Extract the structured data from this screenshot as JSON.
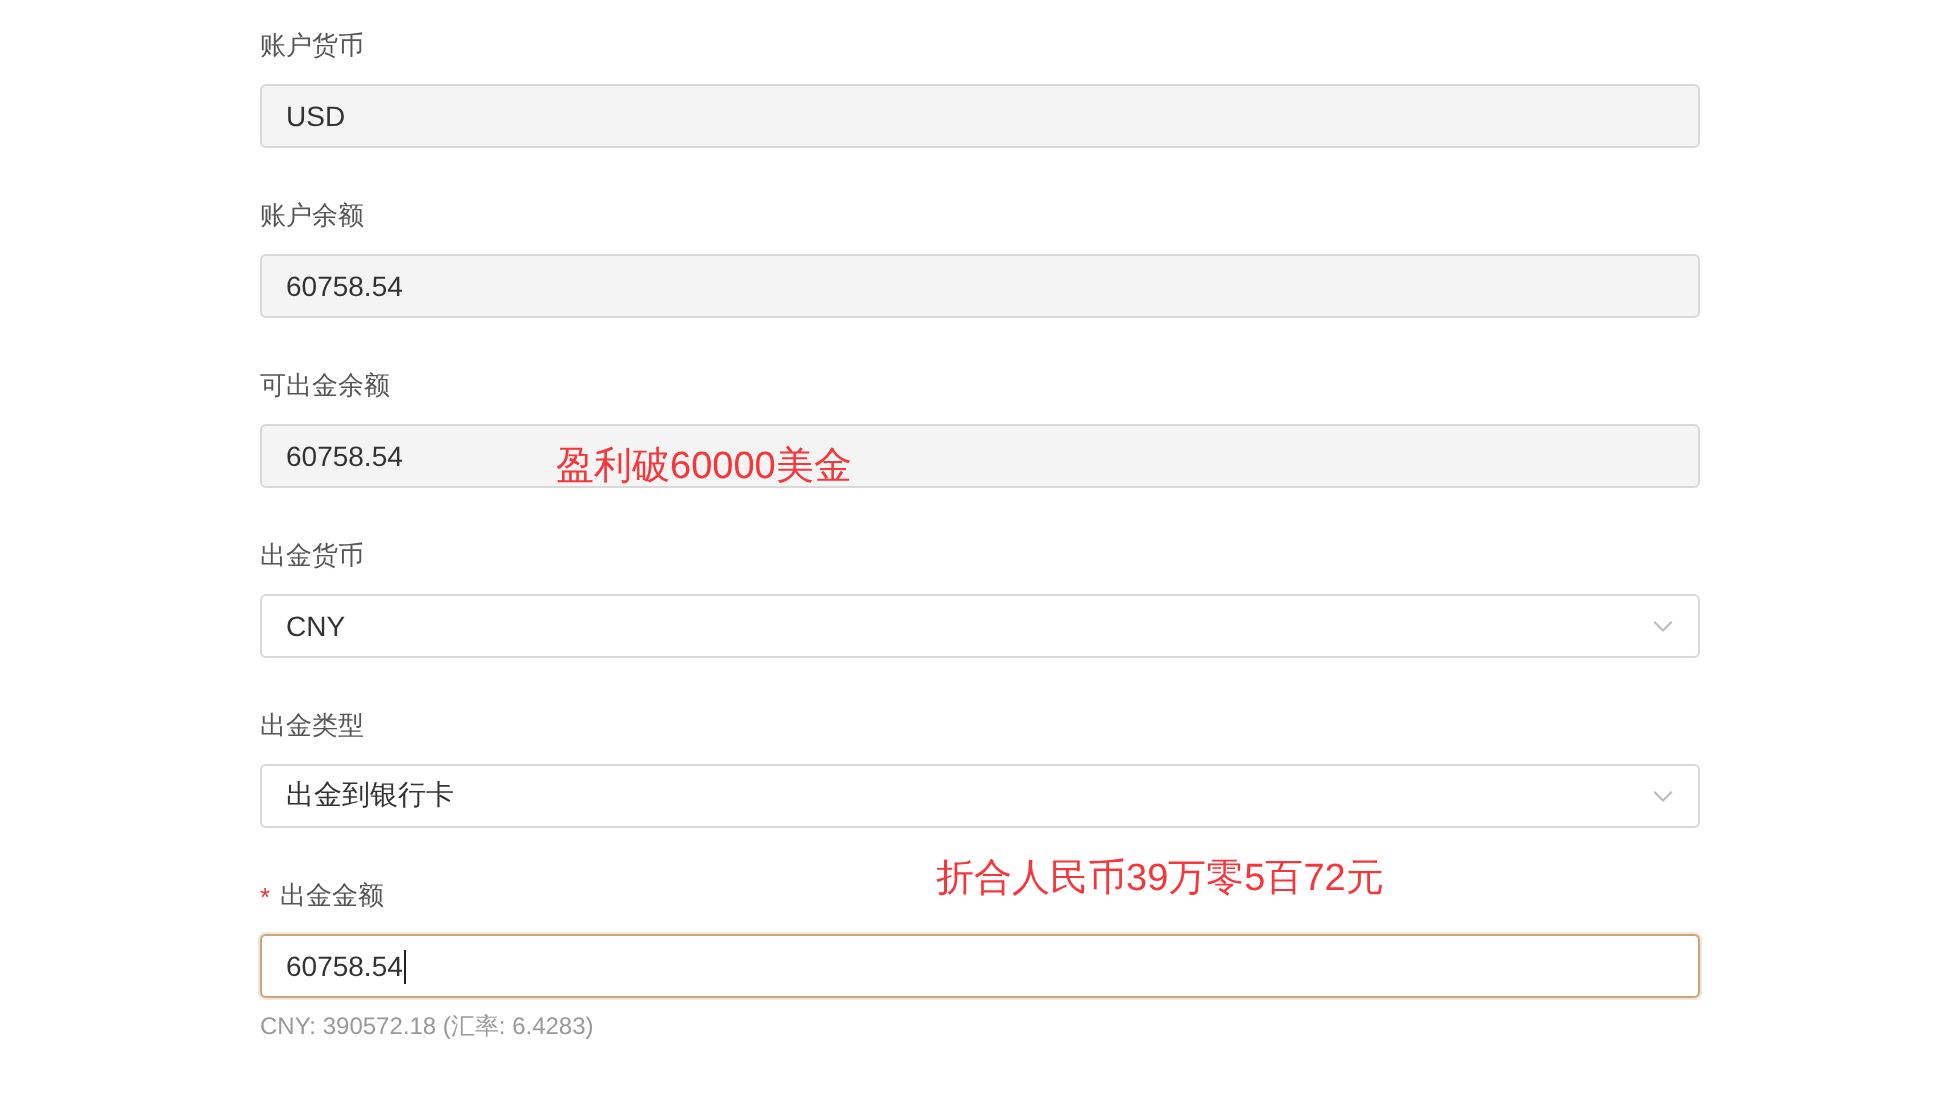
{
  "fields": [
    {
      "label": "账户货币",
      "value": "USD",
      "kind": "readonly",
      "required": false,
      "focused": false
    },
    {
      "label": "账户余额",
      "value": "60758.54",
      "kind": "readonly",
      "required": false,
      "focused": false
    },
    {
      "label": "可出金余额",
      "value": "60758.54",
      "kind": "readonly",
      "required": false,
      "focused": false
    },
    {
      "label": "出金货币",
      "value": "CNY",
      "kind": "select",
      "required": false,
      "focused": false
    },
    {
      "label": "出金类型",
      "value": "出金到银行卡",
      "kind": "select",
      "required": false,
      "focused": false
    },
    {
      "label": "出金金额",
      "value": "60758.54",
      "kind": "input",
      "required": true,
      "required_mark": "*",
      "focused": true,
      "hint": "CNY: 390572.18 (汇率: 6.4283)"
    }
  ],
  "annotations": [
    {
      "text": "盈利破60000美金"
    },
    {
      "text": "折合人民币39万零5百72元"
    }
  ]
}
